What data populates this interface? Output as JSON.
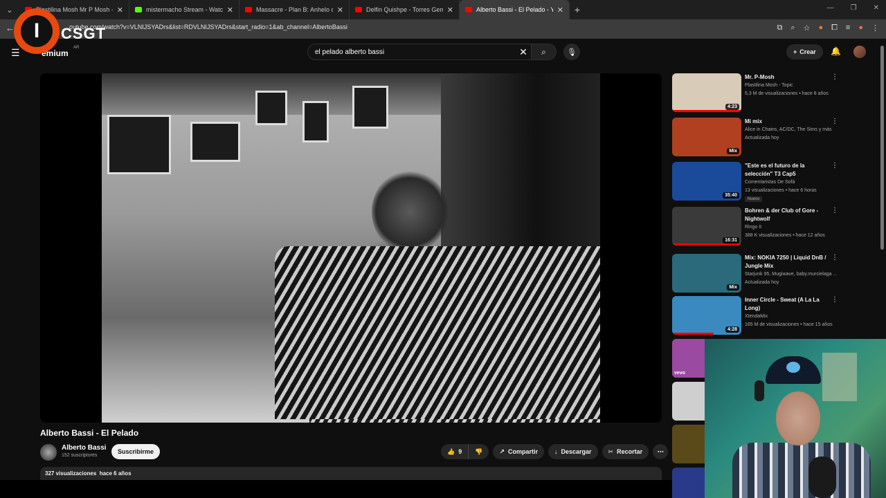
{
  "browser": {
    "tabs": [
      {
        "title": "Plastilina Mosh Mr P Mosh - Yo",
        "favicon_color": "#ff0000",
        "active": false
      },
      {
        "title": "mistermacho Stream - Watch Li",
        "favicon_color": "#53fc18",
        "active": false
      },
      {
        "title": "Massacre - Plan B: Anhelo de s",
        "favicon_color": "#ff0000",
        "active": false
      },
      {
        "title": "Delfin Quishpe - Torres Gemela",
        "favicon_color": "#ff0000",
        "active": false
      },
      {
        "title": "Alberto Bassi - El Pelado - Y",
        "favicon_color": "#ff0000",
        "active": true
      }
    ],
    "url": "outube.com/watch?v=VLNIJSYADrs&list=RDVLNIJSYADrs&start_radio=1&ab_channel=AlbertoBassi"
  },
  "overlay": {
    "logo_letter": "I",
    "logo_text": "CSGT"
  },
  "header": {
    "brand": "Premium",
    "brand_visible": "emium",
    "country": "AR",
    "search_value": "el pelado alberto bassi",
    "create_label": "Crear"
  },
  "video": {
    "title": "Alberto Bassi - El Pelado",
    "channel": "Alberto Bassi",
    "subscribers": "152 suscriptores",
    "subscribe_label": "Suscribirme",
    "likes": "9",
    "share_label": "Compartir",
    "download_label": "Descargar",
    "clip_label": "Recortar",
    "views": "327 visualizaciones",
    "age": "hace 6 años"
  },
  "recommendations": [
    {
      "title": "Mr. P-Mosh",
      "channel": "Plastilina Mosh - Topic",
      "meta": "5,3 M de visualizaciones • hace 8 años",
      "duration": "4:23",
      "thumb": "#d8cbb8",
      "progress": 1.0
    },
    {
      "title": "Mi mix",
      "channel": "Alice in Chains, AC/DC, The Sims y más",
      "meta": "Actualizada hoy",
      "duration": "Mix",
      "thumb": "#b04020",
      "progress": 0
    },
    {
      "title": "\"Este es el futuro de la selección\" T3 Cap5",
      "channel": "Comentaristas De Sofá",
      "meta": "13 visualizaciones • hace 6 horas",
      "duration": "35:40",
      "thumb": "#1a4a9a",
      "badge": "Nuevo",
      "progress": 0
    },
    {
      "title": "Bohren & der Club of Gore - Nightwolf",
      "channel": "Ringo II",
      "meta": "388 K visualizaciones • hace 12 años",
      "duration": "16:31",
      "thumb": "#3a3a3a",
      "progress": 1.0
    },
    {
      "title": "Mix: NOKIA 7250 | Liquid DnB / Jungle Mix",
      "channel": "Starjunk 95, Mugiwave, baby.murcielaga ...",
      "meta": "Actualizada hoy",
      "duration": "Mix",
      "thumb": "#2a6a7a",
      "progress": 0
    },
    {
      "title": "Inner Circle - Sweat (A La La Long)",
      "channel": "XtendaMix",
      "meta": "165 M de visualizaciones • hace 15 años",
      "duration": "4:28",
      "thumb": "#3a8ac0",
      "progress": 0.6
    }
  ],
  "partial_thumbs": [
    {
      "label": "vevo",
      "color": "#9a4aa0"
    },
    {
      "label": "",
      "color": "#cfcfcf"
    },
    {
      "label": "",
      "color": "#5a4a1a"
    },
    {
      "label": "",
      "color": "#2a3a8a"
    }
  ]
}
